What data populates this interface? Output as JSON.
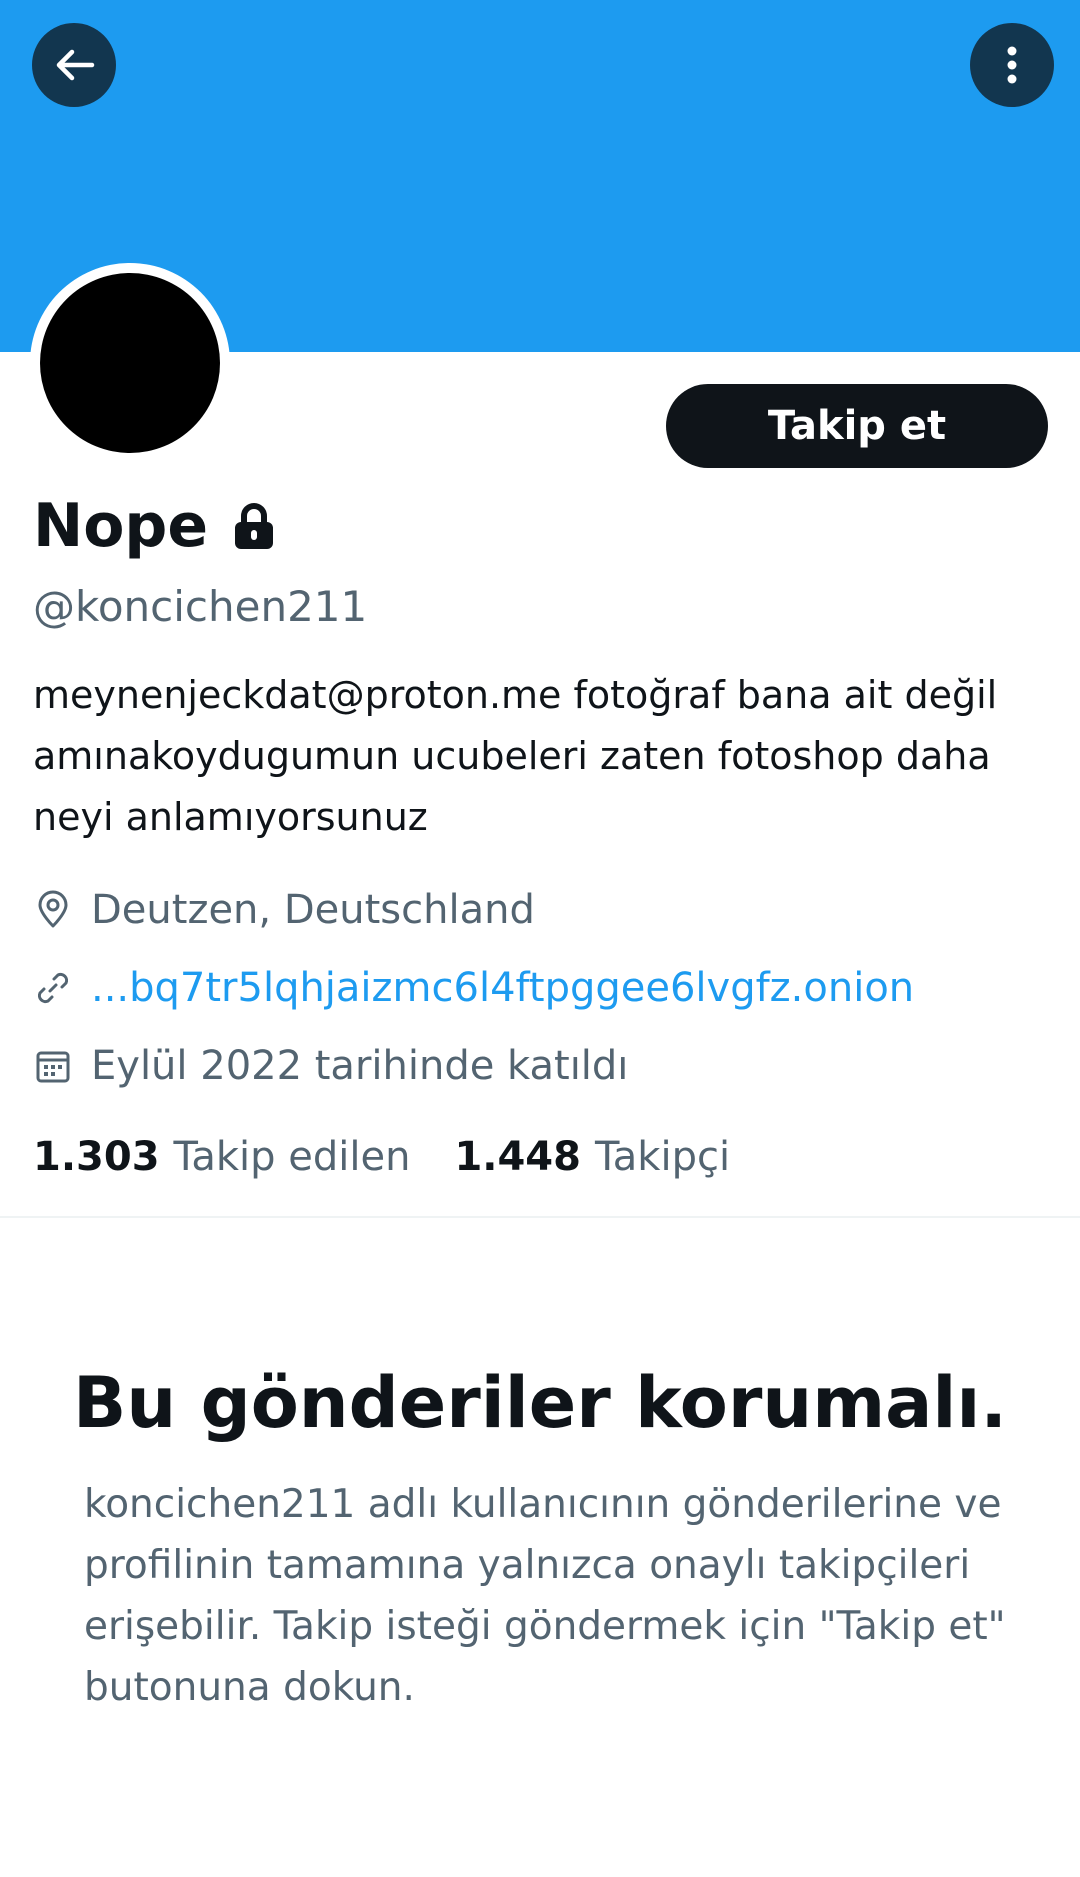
{
  "header": {
    "back_icon": "arrow-left-icon",
    "more_icon": "more-vertical-icon",
    "banner_color": "#1d9bf0"
  },
  "profile": {
    "display_name": "Nope",
    "lock_icon": "lock-icon",
    "handle": "@koncichen211",
    "follow_label": "Takip et",
    "bio": "meynenjeckdat@proton.me fotoğraf bana ait değil amınakoydugumun ucubeleri zaten fotoshop daha neyi anlamıyorsunuz",
    "location": "Deutzen, Deutschland",
    "website": "...bq7tr5lqhjaizmc6l4ftpggee6lvgfz.onion",
    "joined": "Eylül 2022 tarihinde katıldı"
  },
  "stats": {
    "following_count": "1.303",
    "following_label": "Takip edilen",
    "followers_count": "1.448",
    "followers_label": "Takipçi"
  },
  "protected": {
    "title": "Bu gönderiler korumalı.",
    "description": "koncichen211 adlı kullanıcının gönderilerine ve profilinin tamamına yalnızca onaylı takipçileri erişebilir. Takip isteği göndermek için \"Takip et\" butonuna dokun."
  },
  "colors": {
    "accent": "#1d9bf0",
    "text_primary": "#0f1419",
    "text_secondary": "#536471"
  }
}
